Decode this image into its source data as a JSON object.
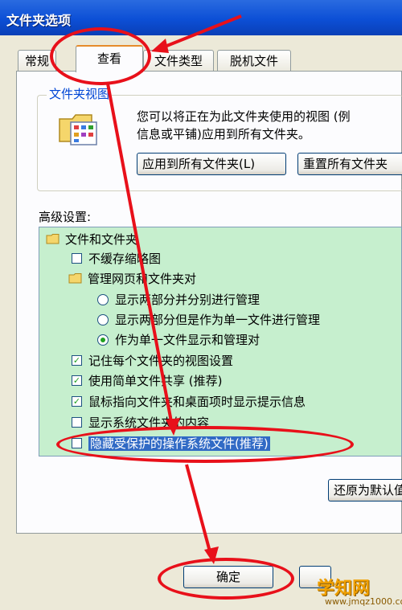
{
  "window": {
    "title": "文件夹选项"
  },
  "tabs": [
    {
      "label": "常规"
    },
    {
      "label": "查看",
      "active": true
    },
    {
      "label": "文件类型"
    },
    {
      "label": "脱机文件"
    }
  ],
  "folder_views": {
    "label": "文件夹视图",
    "description_line1": "您可以将正在为此文件夹使用的视图 (例",
    "description_line2": "信息或平铺)应用到所有文件夹。",
    "apply_button": "应用到所有文件夹(L)",
    "reset_button": "重置所有文件夹"
  },
  "advanced": {
    "label": "高级设置:",
    "items": [
      {
        "type": "folder",
        "label": "文件和文件夹"
      },
      {
        "type": "checkbox",
        "checked": false,
        "label": "不缓存缩略图"
      },
      {
        "type": "folder",
        "label": "管理网页和文件夹对"
      },
      {
        "type": "radio",
        "checked": false,
        "label": "显示两部分并分别进行管理"
      },
      {
        "type": "radio",
        "checked": false,
        "label": "显示两部分但是作为单一文件进行管理"
      },
      {
        "type": "radio",
        "checked": true,
        "label": "作为单一文件显示和管理对"
      },
      {
        "type": "checkbox",
        "checked": true,
        "label": "记住每个文件夹的视图设置"
      },
      {
        "type": "checkbox",
        "checked": true,
        "label": "使用简单文件共享 (推荐)"
      },
      {
        "type": "checkbox",
        "checked": true,
        "label": "鼠标指向文件夹和桌面项时显示提示信息"
      },
      {
        "type": "checkbox",
        "checked": false,
        "label": "显示系统文件夹的内容"
      },
      {
        "type": "checkbox",
        "checked": false,
        "label": "隐藏受保护的操作系统文件(推荐)",
        "highlighted": true
      }
    ],
    "restore_button": "还原为默认值"
  },
  "footer": {
    "ok_button": "确定"
  },
  "watermark": {
    "text": "学知网",
    "url": "www.jmqz1000.com"
  },
  "colors": {
    "annotation": "#e8101a",
    "selection": "#316ac5",
    "list_bg": "#c6efce"
  }
}
